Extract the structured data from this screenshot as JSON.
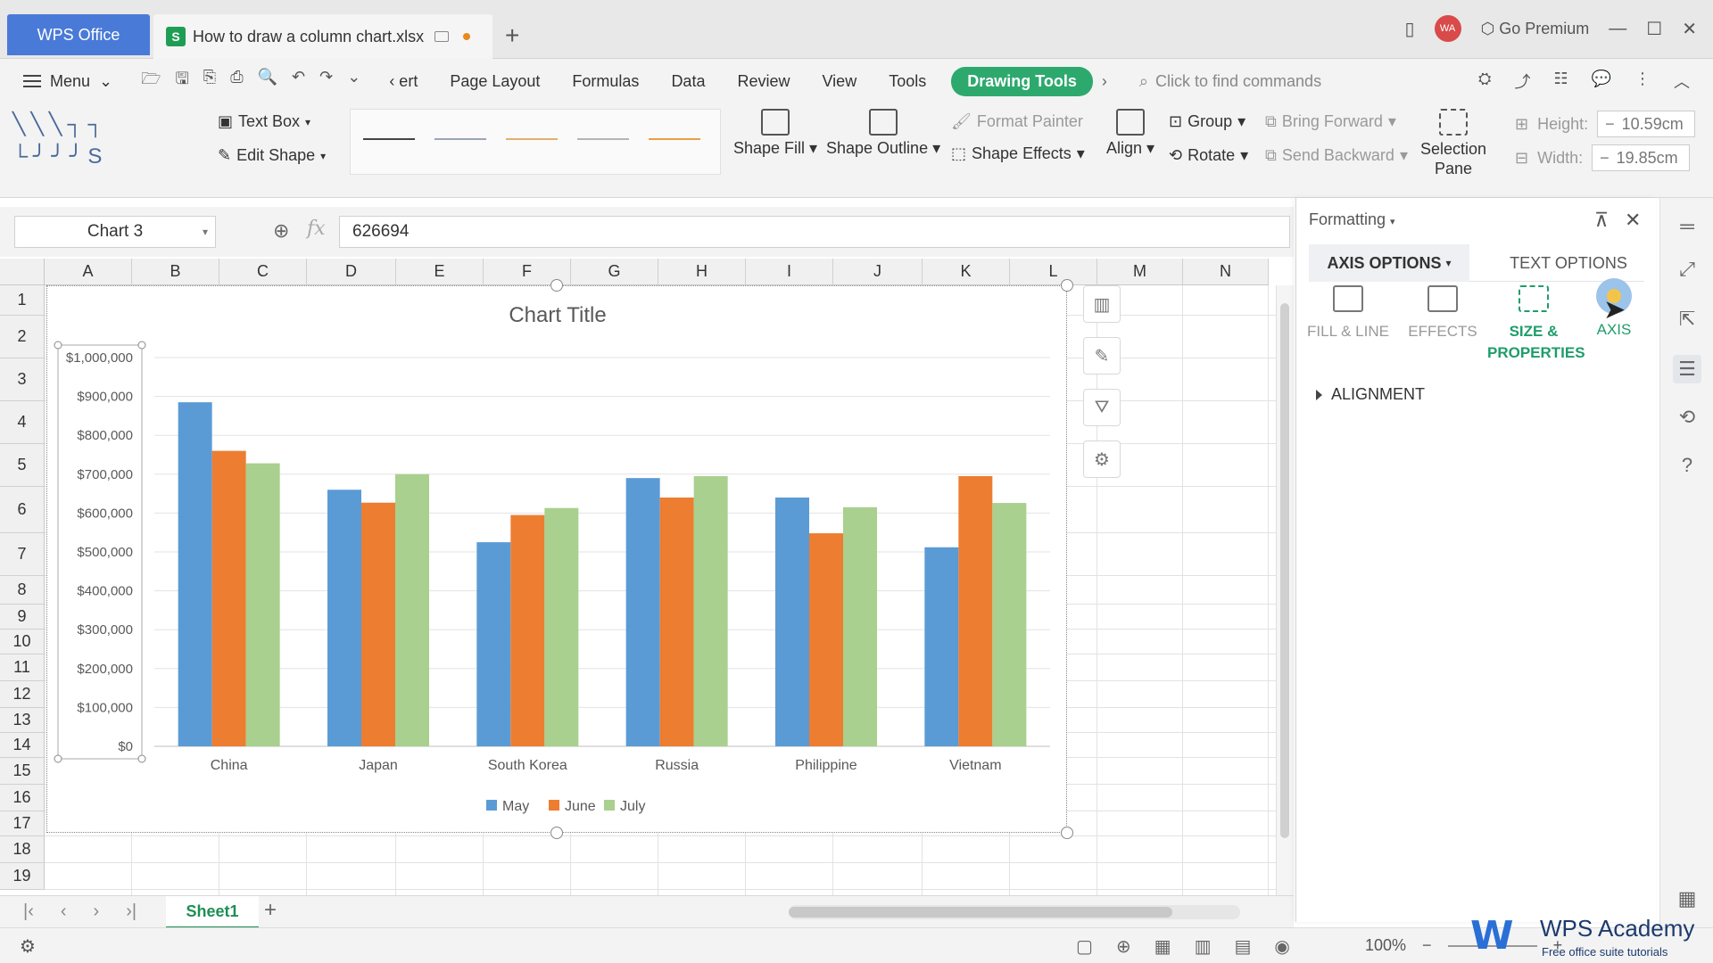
{
  "titlebar": {
    "app_tab": "WPS Office",
    "doc_tab": "How to draw a column chart.xlsx",
    "doc_badge": "S",
    "new_tab": "+",
    "premium": "Go Premium",
    "avatar_initials": "WA"
  },
  "menubar": {
    "menu_label": "Menu",
    "tabs": [
      "‹ ert",
      "Page Layout",
      "Formulas",
      "Data",
      "Review",
      "View",
      "Tools"
    ],
    "drawing_tools": "Drawing Tools",
    "find_placeholder": "Click to find commands"
  },
  "ribbon": {
    "text_box": "Text Box",
    "edit_shape": "Edit Shape",
    "shape_fill": "Shape Fill",
    "shape_outline": "Shape Outline",
    "format_painter": "Format Painter",
    "shape_effects": "Shape Effects",
    "align": "Align",
    "group": "Group",
    "rotate": "Rotate",
    "bring_forward": "Bring Forward",
    "send_backward": "Send Backward",
    "selection_pane_1": "Selection",
    "selection_pane_2": "Pane",
    "height_label": "Height:",
    "height_value": "10.59cm",
    "width_label": "Width:",
    "width_value": "19.85cm",
    "line_colors": [
      "#444444",
      "#9aa5b8",
      "#e0b070",
      "#b5b5b5",
      "#e6a04a"
    ]
  },
  "formulabar": {
    "name_box": "Chart 3",
    "fx": "fx",
    "value": "626694"
  },
  "grid": {
    "columns": [
      "A",
      "B",
      "C",
      "D",
      "E",
      "F",
      "G",
      "H",
      "I",
      "J",
      "K",
      "L",
      "M",
      "N"
    ],
    "rows": [
      "1",
      "2",
      "3",
      "4",
      "5",
      "6",
      "7",
      "8",
      "9",
      "10",
      "11",
      "12",
      "13",
      "14",
      "15",
      "16",
      "17",
      "18",
      "19"
    ]
  },
  "chart_data": {
    "type": "bar",
    "title": "Chart Title",
    "categories": [
      "China",
      "Japan",
      "South Korea",
      "Russia",
      "Philippine",
      "Vietnam"
    ],
    "series": [
      {
        "name": "May",
        "color": "#5b9bd5",
        "values": [
          885000,
          660000,
          525000,
          690000,
          640000,
          512000
        ]
      },
      {
        "name": "June",
        "color": "#ed7d31",
        "values": [
          760000,
          626694,
          595000,
          640000,
          548000,
          695000
        ]
      },
      {
        "name": "July",
        "color": "#a9d08e",
        "values": [
          728000,
          700000,
          613000,
          695000,
          615000,
          626000
        ]
      }
    ],
    "ylim": [
      0,
      1000000
    ],
    "yticks": [
      "$0",
      "$100,000",
      "$200,000",
      "$300,000",
      "$400,000",
      "$500,000",
      "$600,000",
      "$700,000",
      "$800,000",
      "$900,000",
      "$1,000,000"
    ],
    "grid": true,
    "legend_position": "bottom"
  },
  "sheetbar": {
    "sheet_name": "Sheet1"
  },
  "statusbar": {
    "zoom": "100%"
  },
  "panel": {
    "title": "Formatting",
    "tab_axis": "AXIS OPTIONS",
    "tab_text": "TEXT OPTIONS",
    "cat_fill": "FILL & LINE",
    "cat_effects": "EFFECTS",
    "cat_size_1": "SIZE &",
    "cat_size_2": "PROPERTIES",
    "cat_axis": "AXIS",
    "alignment": "ALIGNMENT"
  },
  "watermark": {
    "brand": "WPS Academy",
    "tagline": "Free office suite tutorials"
  }
}
